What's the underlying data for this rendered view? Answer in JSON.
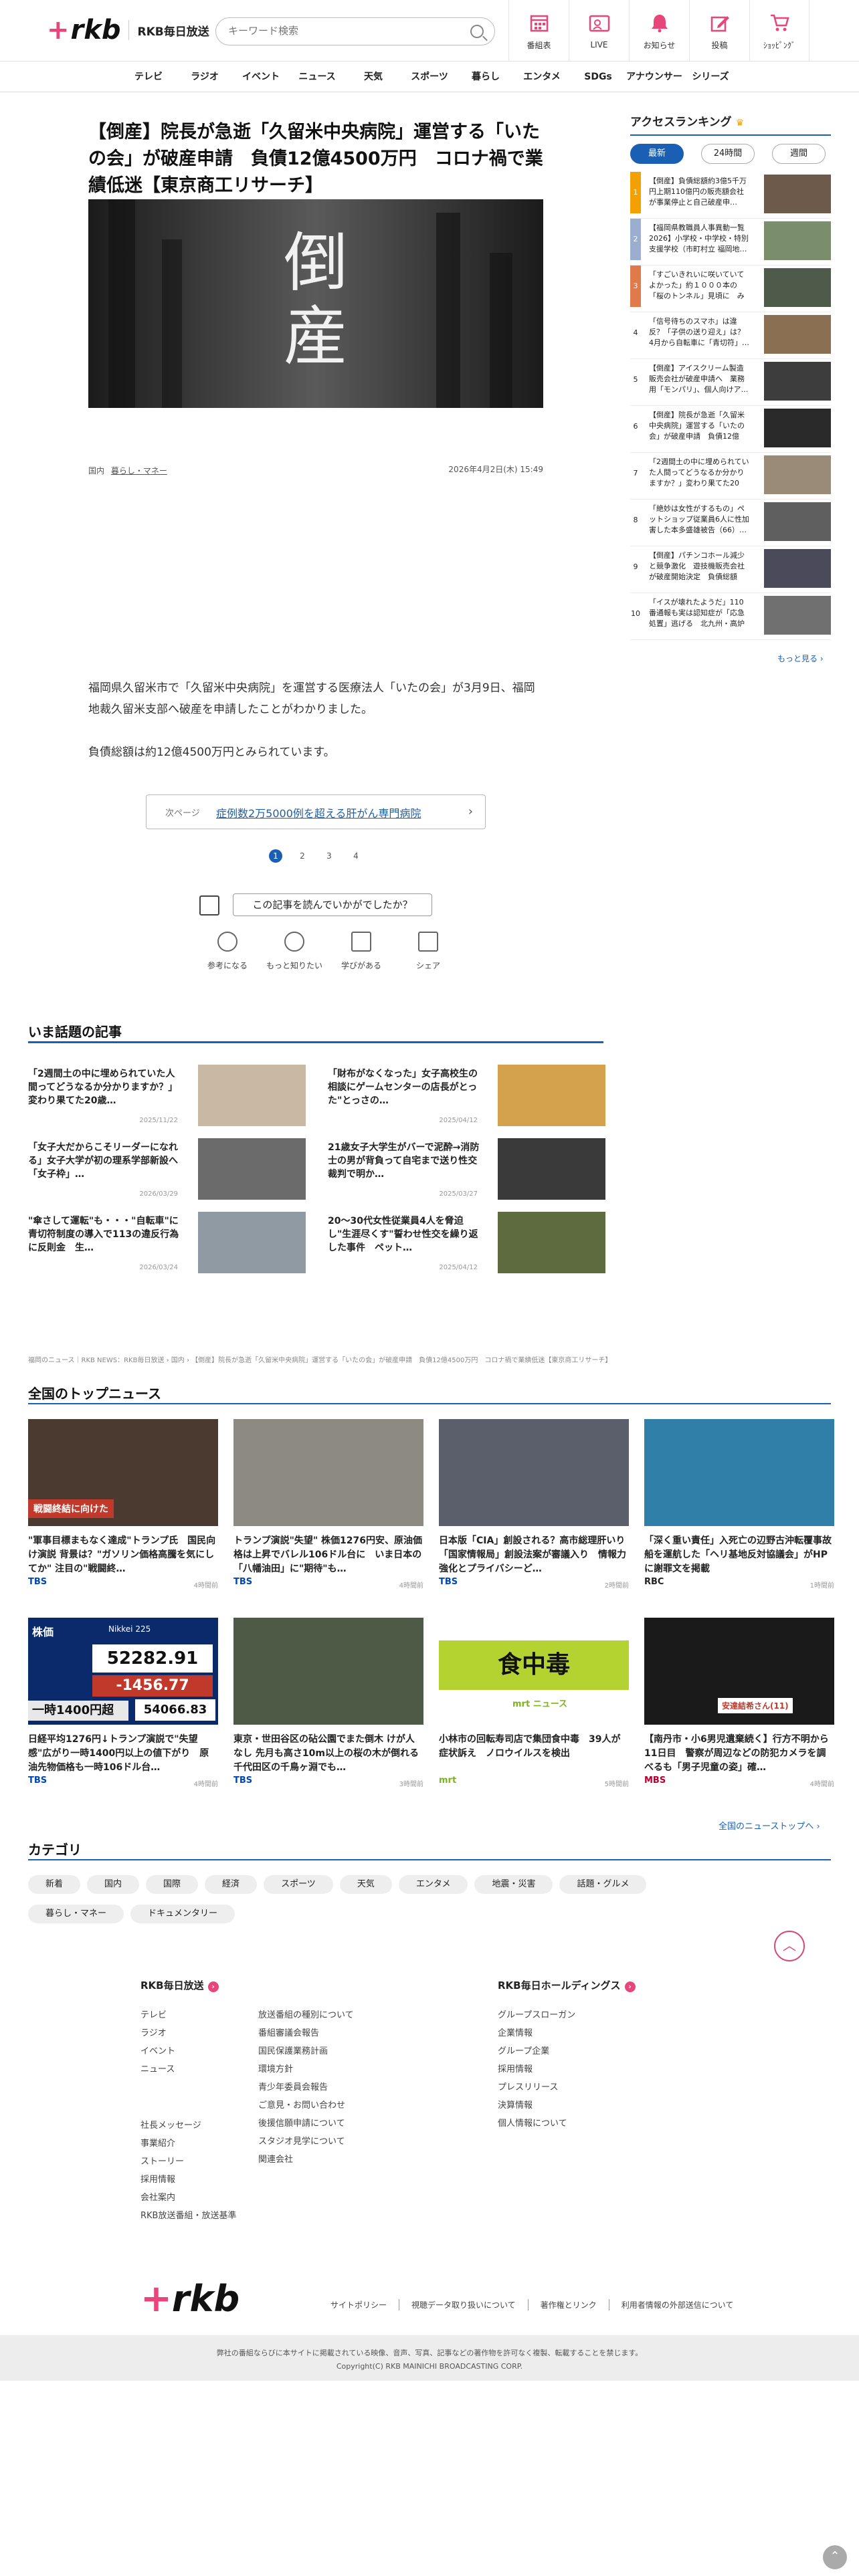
{
  "header": {
    "logo_mark": "+rkb",
    "station": "RKB毎日放送",
    "search_placeholder": "キーワード検索",
    "nav": [
      {
        "label": "番組表",
        "icon": "calendar-icon"
      },
      {
        "label": "LIVE",
        "icon": "tv-icon"
      },
      {
        "label": "お知らせ",
        "icon": "bell-icon"
      },
      {
        "label": "投稿",
        "icon": "pen-icon"
      },
      {
        "label": "ｼｮｯﾋﾟﾝｸﾞ",
        "icon": "cart-icon"
      }
    ],
    "accent": "#e8457a"
  },
  "gnav": [
    "テレビ",
    "ラジオ",
    "イベント",
    "ニュース",
    "天気",
    "スポーツ",
    "暮らし",
    "エンタメ",
    "SDGs",
    "アナウンサー",
    "シリーズ"
  ],
  "article": {
    "title": "【倒産】院長が急逝「久留米中央病院」運営する「いたの会」が破産申請　負債12億4500万円　コロナ禍で業績低迷【東京商工リサーチ】",
    "hero_chars": "倒産",
    "tags": [
      "国内",
      "暮らし・マネー"
    ],
    "date": "2026年4月2日(木) 15:49",
    "body_para1": "福岡県久留米市で「久留米中央病院」を運営する医療法人「いたの会」が3月9日、福岡地裁久留米支部へ破産を申請したことがわかりました。",
    "body_para2": "負債総額は約12億4500万円とみられています。",
    "next_label": "次ページ",
    "next_title": "症例数2万5000例を超える肝がん専門病院",
    "pages": [
      "1",
      "2",
      "3",
      "4"
    ],
    "current_page": "1",
    "survey_label": "この記事を読んでいかがでしたか？",
    "reactions": [
      "参考になる",
      "もっと知りたい",
      "学びがある",
      "シェア"
    ]
  },
  "ranking": {
    "title": "アクセスランキング",
    "tabs": [
      "最新",
      "24時間",
      "週間"
    ],
    "items": [
      {
        "rank": "1",
        "text": "【倒産】負債総額約3億5千万円上期110億円の販売額会社が事業停止と自己破産申…",
        "color": "#f2a100"
      },
      {
        "rank": "2",
        "text": "【福岡県教職員人事異動一覧 2026】小学校・中学校・特別支援学校（市町村立 福岡地…",
        "color": "#9aaed0"
      },
      {
        "rank": "3",
        "text": "「すごいきれいに咲いていてよかった」約１０００本の「桜のトンネル」見頃に　みや…",
        "color": "#e07a4a"
      },
      {
        "rank": "4",
        "text": "「信号待ちのスマホ」は違反？「子供の送り迎え」は？　4月から自転車に「青切符」…",
        "color": ""
      },
      {
        "rank": "5",
        "text": "【倒産】アイスクリーム製造販売会社が破産申請へ　業務用「モンパリ」、個人向けア…",
        "color": ""
      },
      {
        "rank": "6",
        "text": "【倒産】院長が急逝「久留米中央病院」運営する「いたの会」が破産申請　負債12億450…",
        "color": ""
      },
      {
        "rank": "7",
        "text": "「2週間土の中に埋められていた人間ってどうなるか分かりますか？」変わり果てた20歳…",
        "color": ""
      },
      {
        "rank": "8",
        "text": "「絶妙は女性がするもの」ペットショップ従業員6人に性加害した本多盛雄被告（66）…",
        "color": ""
      },
      {
        "rank": "9",
        "text": "【倒産】パチンコホール減少と競争激化　遊技機販売会社が破産開始決定　負債総額は…",
        "color": ""
      },
      {
        "rank": "10",
        "text": "「イスが壊れたようだ」110番通報も実は認知症が「応急処置」逃げる　北九州・高炉台公園…",
        "color": ""
      }
    ],
    "more": "もっと見る ›"
  },
  "popular": {
    "title": "いま話題の記事",
    "items": [
      {
        "title": "「2週間土の中に埋められていた人間ってどうなるか分かりますか？」変わり果てた20歳…",
        "date": "2025/11/22"
      },
      {
        "title": "「財布がなくなった」女子高校生の相談にゲームセンターの店長がとった\"とっさの…",
        "date": "2025/04/12"
      },
      {
        "title": "「女子大だからこそリーダーになれる」女子大学が初の理系学部新設へ「女子枠」…",
        "date": "2026/03/29"
      },
      {
        "title": "21歳女子大学生がバーで泥酔→消防士の男が背負って自宅まで送り性交　裁判で明か…",
        "date": "2025/03/27"
      },
      {
        "title": "\"傘さして運転\"も・・・\"自転車\"に青切符制度の導入で113の違反行為に反則金　生…",
        "date": "2026/03/24"
      },
      {
        "title": "20〜30代女性従業員4人を脅迫し\"生涯尽くす\"誓わせ性交を繰り返した事件　ペット…",
        "date": "2025/04/12"
      }
    ]
  },
  "breadcrumb": "福岡のニュース｜RKB NEWS：RKB毎日放送 › 国内 › 【倒産】院長が急逝「久留米中央病院」運営する「いたの会」が破産申請　負債12億4500万円　コロナ禍で業績低迷【東京商工リサーチ】",
  "national": {
    "title": "全国のトップニュース",
    "items": [
      {
        "title": "\"軍事目標まもなく達成\"トランプ氏　国民向け演説 背景は？\"ガソリン価格高騰を気にしてか\" 注目の\"戦闘終…",
        "src": "TBS",
        "srcColor": "#0047b3",
        "date": "4時間前",
        "caption": "戦闘終結に向けた",
        "price": ""
      },
      {
        "title": "トランプ演説\"失望\" 株価1276円安、原油価格は上昇でバレル106ドル台に　いま日本の「八幡油田」に\"期待\"も…",
        "src": "TBS",
        "srcColor": "#0047b3",
        "date": "4時間前",
        "caption": "",
        "price": ""
      },
      {
        "title": "日本版「CIA」創設される？高市総理肝いり「国家情報局」創設法案が審議入り　情報力強化とプライバシーど…",
        "src": "TBS",
        "srcColor": "#0047b3",
        "date": "2時間前",
        "caption": "",
        "price": ""
      },
      {
        "title": "「深く重い責任」入死亡の辺野古沖転覆事故　船を運航した「ヘリ基地反対協議会」がHPに謝罪文を掲載",
        "src": "RBC",
        "srcColor": "#222222",
        "date": "1時間前",
        "caption": "",
        "price": ""
      },
      {
        "title": "日経平均1276円↓トランプ演説で\"失望感\"広がり一時1400円以上の値下がり　原油先物価格も一時106ドル台…",
        "src": "TBS",
        "srcColor": "#0047b3",
        "date": "4時間前",
        "caption": "",
        "price": "52282.91"
      },
      {
        "title": "東京・世田谷区の砧公園でまた倒木 けが人なし 先月も高さ10m以上の桜の木が倒れる　千代田区の千鳥ヶ淵でも…",
        "src": "TBS",
        "srcColor": "#0047b3",
        "date": "3時間前",
        "caption": "",
        "price": ""
      },
      {
        "title": "小林市の回転寿司店で集団食中毒　39人が症状訴え　ノロウイルスを検出",
        "src": "mrt",
        "srcColor": "#7cb518",
        "date": "5時間前",
        "caption": "食中毒",
        "price": ""
      },
      {
        "title": "【南丹市・小6男児遺棄続く】行方不明から11日目　警察が周辺などの防犯カメラを調べるも「男子児童の姿」確…",
        "src": "MBS",
        "srcColor": "#b8002e",
        "date": "4時間前",
        "caption": "安達結希さん(11)",
        "price": ""
      }
    ],
    "more": "全国のニューストップへ ›",
    "nikkei_label": "Nikkei 225",
    "nikkei_change": "-1456.77",
    "nikkei_low": "54066.83",
    "stock_tag": "株価",
    "drop_text": "一時1400円超",
    "mrt_label": "mrt ニュース"
  },
  "category": {
    "title": "カテゴリ",
    "items": [
      "新着",
      "国内",
      "国際",
      "経済",
      "スポーツ",
      "天気",
      "エンタメ",
      "地震・災害",
      "話題・グルメ",
      "暮らし・マネー",
      "ドキュメンタリー"
    ]
  },
  "footer": {
    "col1_title": "RKB毎日放送",
    "col1_a": [
      "テレビ",
      "ラジオ",
      "イベント",
      "ニュース"
    ],
    "col1_b": [
      "社長メッセージ",
      "事業紹介",
      "ストーリー",
      "採用情報",
      "会社案内",
      "RKB放送番組・放送基準"
    ],
    "col2": [
      "放送番組の種別について",
      "番組審議会報告",
      "国民保護業務計画",
      "環境方針",
      "青少年委員会報告",
      "ご意見・お問い合わせ",
      "後援信願申請について",
      "スタジオ見学について",
      "関連会社"
    ],
    "col3_title": "RKB毎日ホールディングス",
    "col3": [
      "グループスローガン",
      "企業情報",
      "グループ企業",
      "採用情報",
      "プレスリリース",
      "決算情報",
      "個人情報について"
    ],
    "links": [
      "サイトポリシー",
      "視聴データ取り扱いについて",
      "著作権とリンク",
      "利用者情報の外部送信について"
    ],
    "notice": "弊社の番組ならびに本サイトに掲載されている映像、音声、写真、記事などの著作物を許可なく複製、転載することを禁じます。",
    "copyright": "Copyright(C) RKB MAINICHI BROADCASTING CORP."
  }
}
